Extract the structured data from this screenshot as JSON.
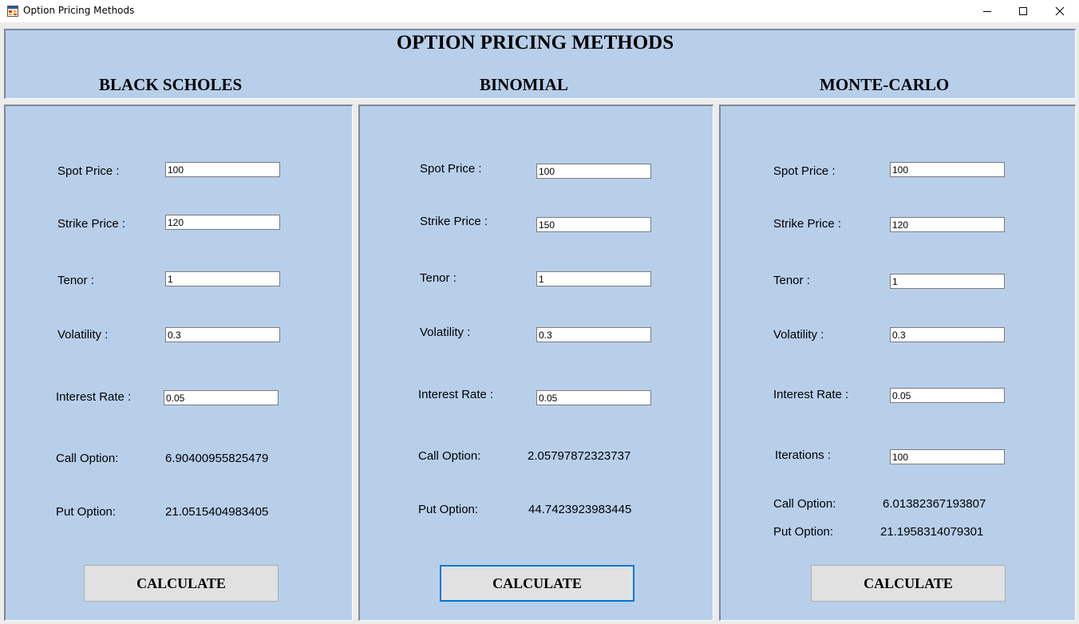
{
  "window": {
    "title": "Option Pricing Methods",
    "icon": "app-form-icon"
  },
  "header": {
    "title": "OPTION PRICING METHODS"
  },
  "methods": {
    "black_scholes": {
      "title": "BLACK SCHOLES",
      "labels": {
        "spot": "Spot Price :",
        "strike": "Strike Price :",
        "tenor": "Tenor :",
        "volatility": "Volatility :",
        "rate": "Interest Rate :",
        "call": "Call Option:",
        "put": "Put Option:"
      },
      "inputs": {
        "spot": "100",
        "strike": "120",
        "tenor": "1",
        "volatility": "0.3",
        "rate": "0.05"
      },
      "results": {
        "call": "6.90400955825479",
        "put": "21.0515404983405"
      },
      "button": "CALCULATE"
    },
    "binomial": {
      "title": "BINOMIAL",
      "labels": {
        "spot": "Spot Price :",
        "strike": "Strike Price :",
        "tenor": "Tenor :",
        "volatility": "Volatility :",
        "rate": "Interest Rate :",
        "call": "Call Option:",
        "put": "Put Option:"
      },
      "inputs": {
        "spot": "100",
        "strike": "150",
        "tenor": "1",
        "volatility": "0.3",
        "rate": "0.05"
      },
      "results": {
        "call": "2.05797872323737",
        "put": "44.7423923983445"
      },
      "button": "CALCULATE"
    },
    "monte_carlo": {
      "title": "MONTE-CARLO",
      "labels": {
        "spot": "Spot Price :",
        "strike": "Strike Price :",
        "tenor": "Tenor :",
        "volatility": "Volatility :",
        "rate": "Interest Rate :",
        "iterations": "Iterations :",
        "call": "Call Option:",
        "put": "Put Option:"
      },
      "inputs": {
        "spot": "100",
        "strike": "120",
        "tenor": "1",
        "volatility": "0.3",
        "rate": "0.05",
        "iterations": "100"
      },
      "results": {
        "call": "6.01382367193807",
        "put": "21.1958314079301"
      },
      "button": "CALCULATE"
    }
  },
  "colors": {
    "panel_bg": "#b8cfea",
    "focus_border": "#0078d7",
    "button_bg": "#e1e1e1"
  }
}
